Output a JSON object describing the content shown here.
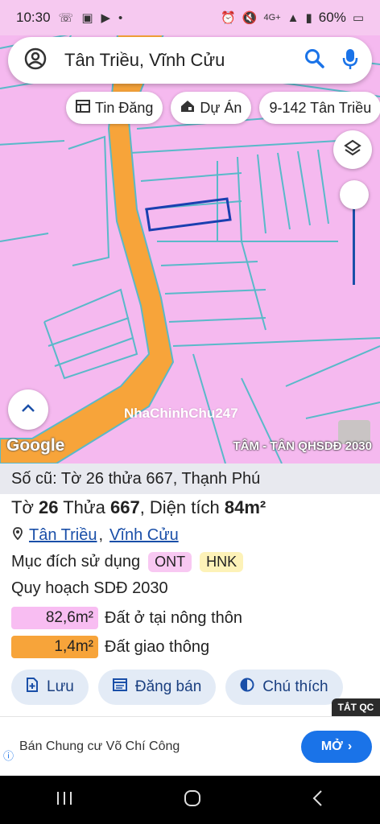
{
  "status": {
    "time": "10:30",
    "battery": "60%",
    "network": "4G+"
  },
  "search": {
    "text": "Tân Triều, Vĩnh Cửu"
  },
  "chips": [
    {
      "label": "Tin Đăng",
      "icon": "listing-icon"
    },
    {
      "label": "Dự Án",
      "icon": "project-house-icon"
    },
    {
      "label": "9-142 Tân Triều",
      "icon": ""
    }
  ],
  "map": {
    "watermark": "NhaChinhChu247",
    "credit": "TÂM - TÂN QHSDĐ 2030",
    "google": "Google",
    "land_color": "#f5b9ef",
    "road_color": "#f7a43a"
  },
  "panel": {
    "old_ref": "Số cũ: Tờ 26 thửa 667, Thạnh Phú",
    "sheet_label": "Tờ",
    "sheet_no": "26",
    "parcel_label": "Thửa",
    "parcel_no": "667",
    "area_label": ", Diện tích",
    "area": "84m²",
    "ward": "Tân Triều",
    "district": "Vĩnh Cửu",
    "purpose_label": "Mục đích sử dụng",
    "badges": [
      "ONT",
      "HNK"
    ],
    "plan_title": "Quy hoạch SDĐ 2030",
    "plans": [
      {
        "area": "82,6m²",
        "label": "Đất ở tại nông thôn",
        "color": "#f8bdf2"
      },
      {
        "area": "1,4m²",
        "label": "Đất giao thông",
        "color": "#f7a43a"
      }
    ],
    "actions": [
      {
        "label": "Lưu",
        "icon": "add-bookmark-icon"
      },
      {
        "label": "Đăng bán",
        "icon": "post-sale-icon"
      },
      {
        "label": "Chú thích",
        "icon": "legend-icon"
      }
    ],
    "tat_qc": "TẮT QC"
  },
  "ad": {
    "text": "Bán Chung cư Võ Chí Công",
    "button": "MỞ"
  }
}
